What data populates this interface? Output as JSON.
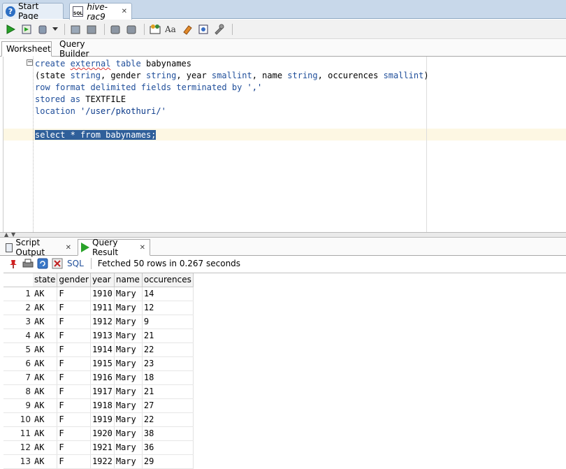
{
  "doc_tabs": [
    {
      "label": "Start Page"
    },
    {
      "label": "hive-rac9"
    }
  ],
  "sub_tabs": [
    "Worksheet",
    "Query Builder"
  ],
  "editor": {
    "lines": [
      "create external table babynames",
      "(state string, gender string, year smallint, name string, occurences smallint)",
      "row format delimited fields terminated by ','",
      "stored as TEXTFILE",
      "location '/user/pkothuri/'",
      "",
      "select * from babynames;"
    ]
  },
  "output_tabs": [
    {
      "label": "Script Output"
    },
    {
      "label": "Query Result"
    }
  ],
  "result_toolbar": {
    "sql_label": "SQL",
    "status": "Fetched 50 rows in 0.267 seconds"
  },
  "grid": {
    "columns": [
      "state",
      "gender",
      "year",
      "name",
      "occurences"
    ],
    "rows": [
      [
        "1",
        "AK",
        "F",
        "1910",
        "Mary",
        "14"
      ],
      [
        "2",
        "AK",
        "F",
        "1911",
        "Mary",
        "12"
      ],
      [
        "3",
        "AK",
        "F",
        "1912",
        "Mary",
        "9"
      ],
      [
        "4",
        "AK",
        "F",
        "1913",
        "Mary",
        "21"
      ],
      [
        "5",
        "AK",
        "F",
        "1914",
        "Mary",
        "22"
      ],
      [
        "6",
        "AK",
        "F",
        "1915",
        "Mary",
        "23"
      ],
      [
        "7",
        "AK",
        "F",
        "1916",
        "Mary",
        "18"
      ],
      [
        "8",
        "AK",
        "F",
        "1917",
        "Mary",
        "21"
      ],
      [
        "9",
        "AK",
        "F",
        "1918",
        "Mary",
        "27"
      ],
      [
        "10",
        "AK",
        "F",
        "1919",
        "Mary",
        "22"
      ],
      [
        "11",
        "AK",
        "F",
        "1920",
        "Mary",
        "38"
      ],
      [
        "12",
        "AK",
        "F",
        "1921",
        "Mary",
        "36"
      ],
      [
        "13",
        "AK",
        "F",
        "1922",
        "Mary",
        "29"
      ]
    ]
  }
}
